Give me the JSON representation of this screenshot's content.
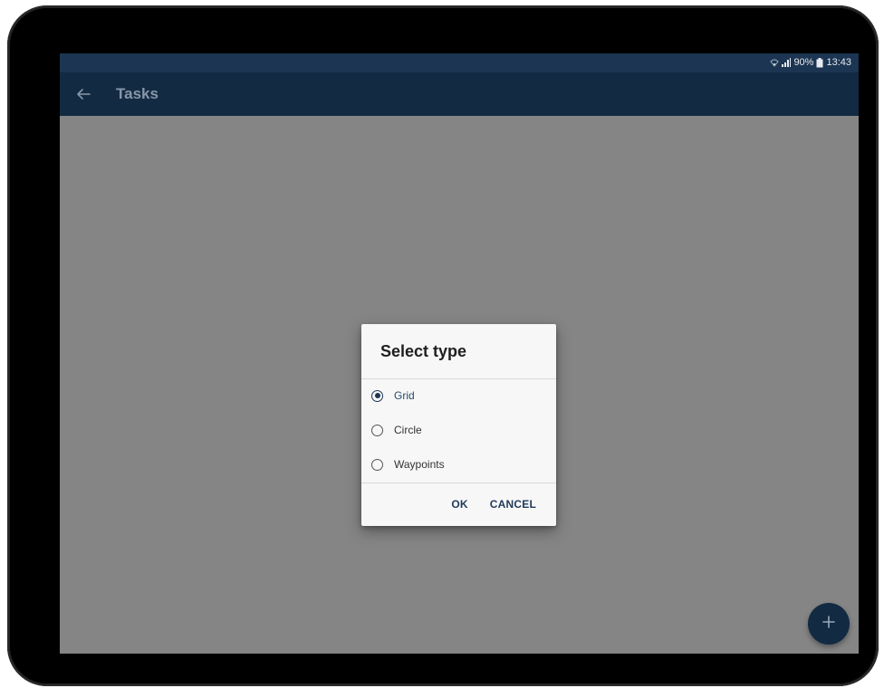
{
  "status_bar": {
    "battery": "90%",
    "time": "13:43",
    "icons": [
      "wifi-icon",
      "signal-icon",
      "battery-icon"
    ]
  },
  "app_bar": {
    "title": "Tasks",
    "back_icon": "arrow-back-icon"
  },
  "dialog": {
    "title": "Select type",
    "options": [
      {
        "label": "Grid",
        "selected": true
      },
      {
        "label": "Circle",
        "selected": false
      },
      {
        "label": "Waypoints",
        "selected": false
      }
    ],
    "ok_label": "OK",
    "cancel_label": "CANCEL"
  },
  "fab": {
    "icon": "plus-icon"
  },
  "colors": {
    "status_bar": "#1c3552",
    "app_bar": "#122a42",
    "scrim": "#858585",
    "accent": "#1c3552",
    "dialog_bg": "#f7f7f7"
  }
}
